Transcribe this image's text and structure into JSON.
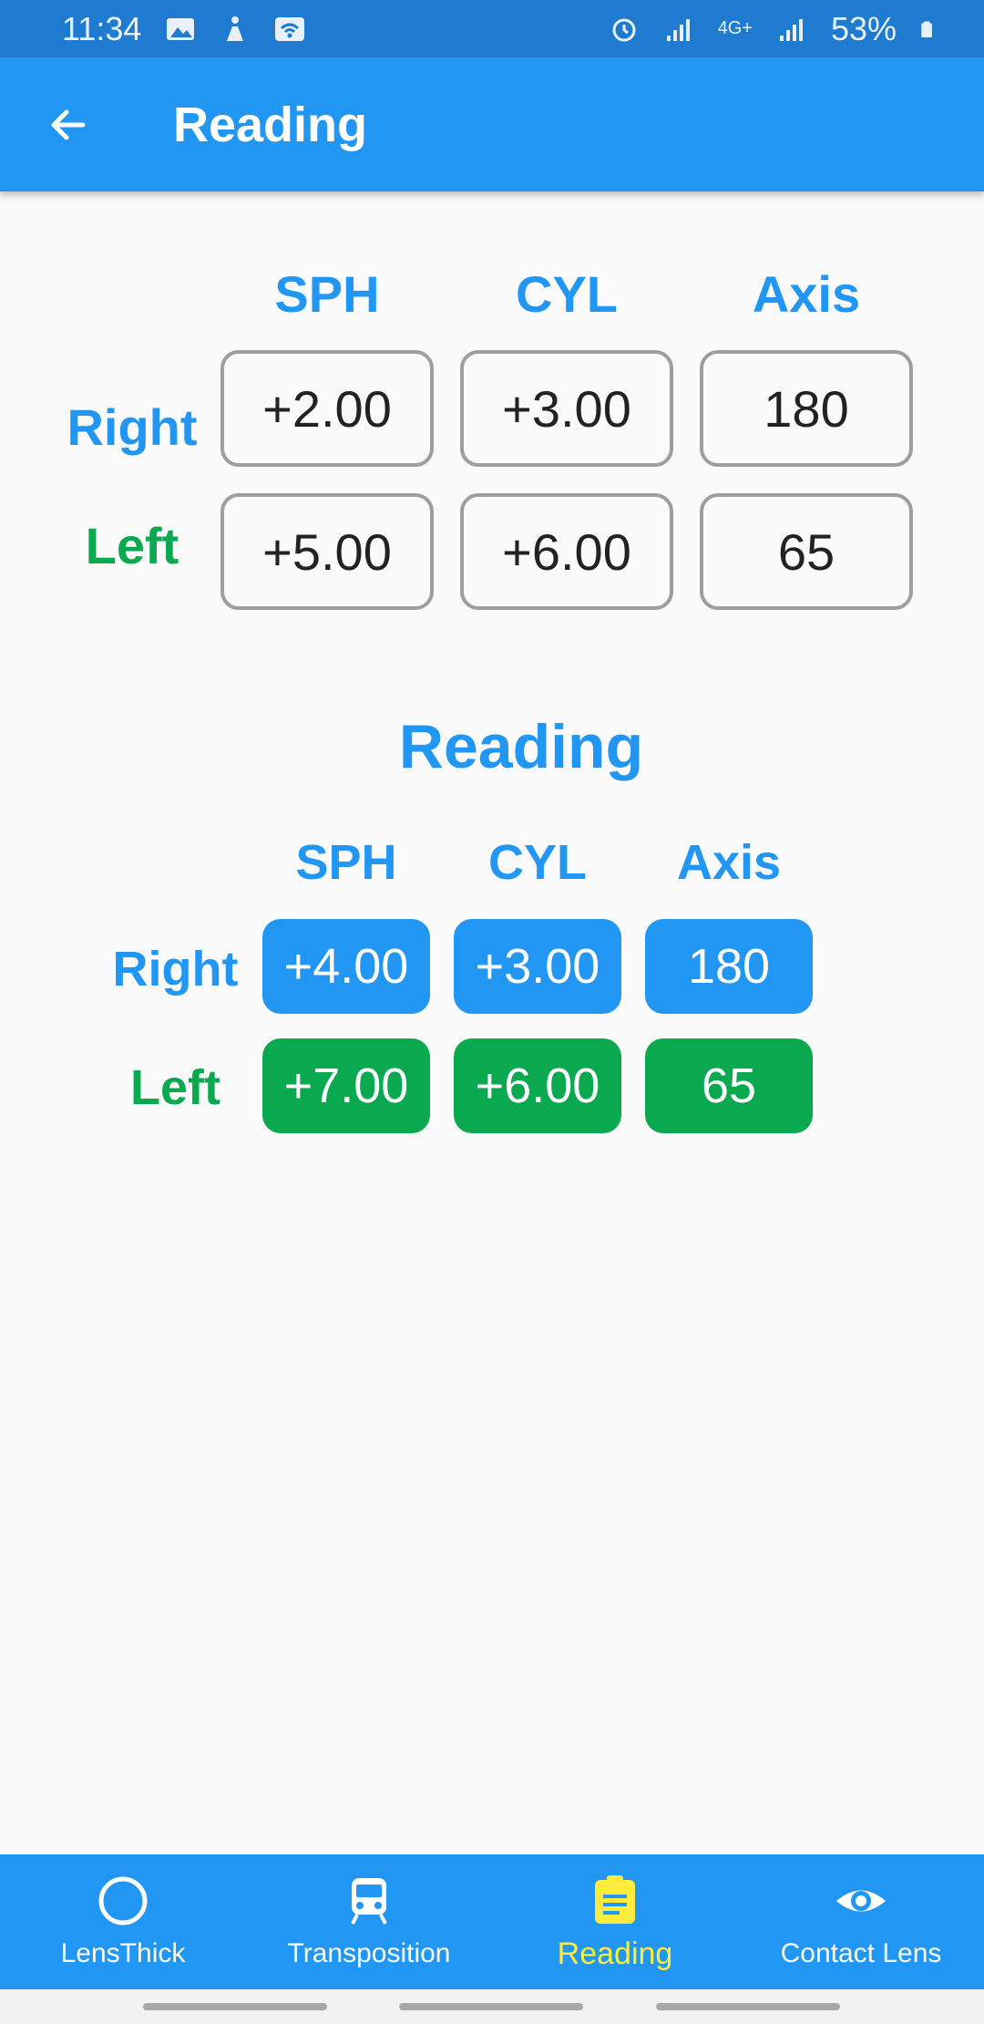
{
  "status": {
    "time": "11:34",
    "network": "4G+",
    "battery": "53%"
  },
  "appbar": {
    "title": "Reading"
  },
  "input_table": {
    "columns": [
      "SPH",
      "CYL",
      "Axis"
    ],
    "rows": [
      {
        "label": "Right",
        "values": [
          "+2.00",
          "+3.00",
          "180"
        ]
      },
      {
        "label": "Left",
        "values": [
          "+5.00",
          "+6.00",
          "65"
        ]
      }
    ]
  },
  "result": {
    "title": "Reading",
    "columns": [
      "SPH",
      "CYL",
      "Axis"
    ],
    "rows": [
      {
        "label": "Right",
        "values": [
          "+4.00",
          "+3.00",
          "180"
        ]
      },
      {
        "label": "Left",
        "values": [
          "+7.00",
          "+6.00",
          "65"
        ]
      }
    ]
  },
  "bottom_nav": {
    "items": [
      {
        "label": "LensThick",
        "icon": "circle-icon"
      },
      {
        "label": "Transposition",
        "icon": "train-icon"
      },
      {
        "label": "Reading",
        "icon": "clipboard-icon",
        "active": true
      },
      {
        "label": "Contact Lens",
        "icon": "eye-icon"
      }
    ]
  },
  "colors": {
    "primary": "#2196f3",
    "right": "#2196f3",
    "left": "#0aa84f",
    "active_nav": "#ffeb3b"
  }
}
